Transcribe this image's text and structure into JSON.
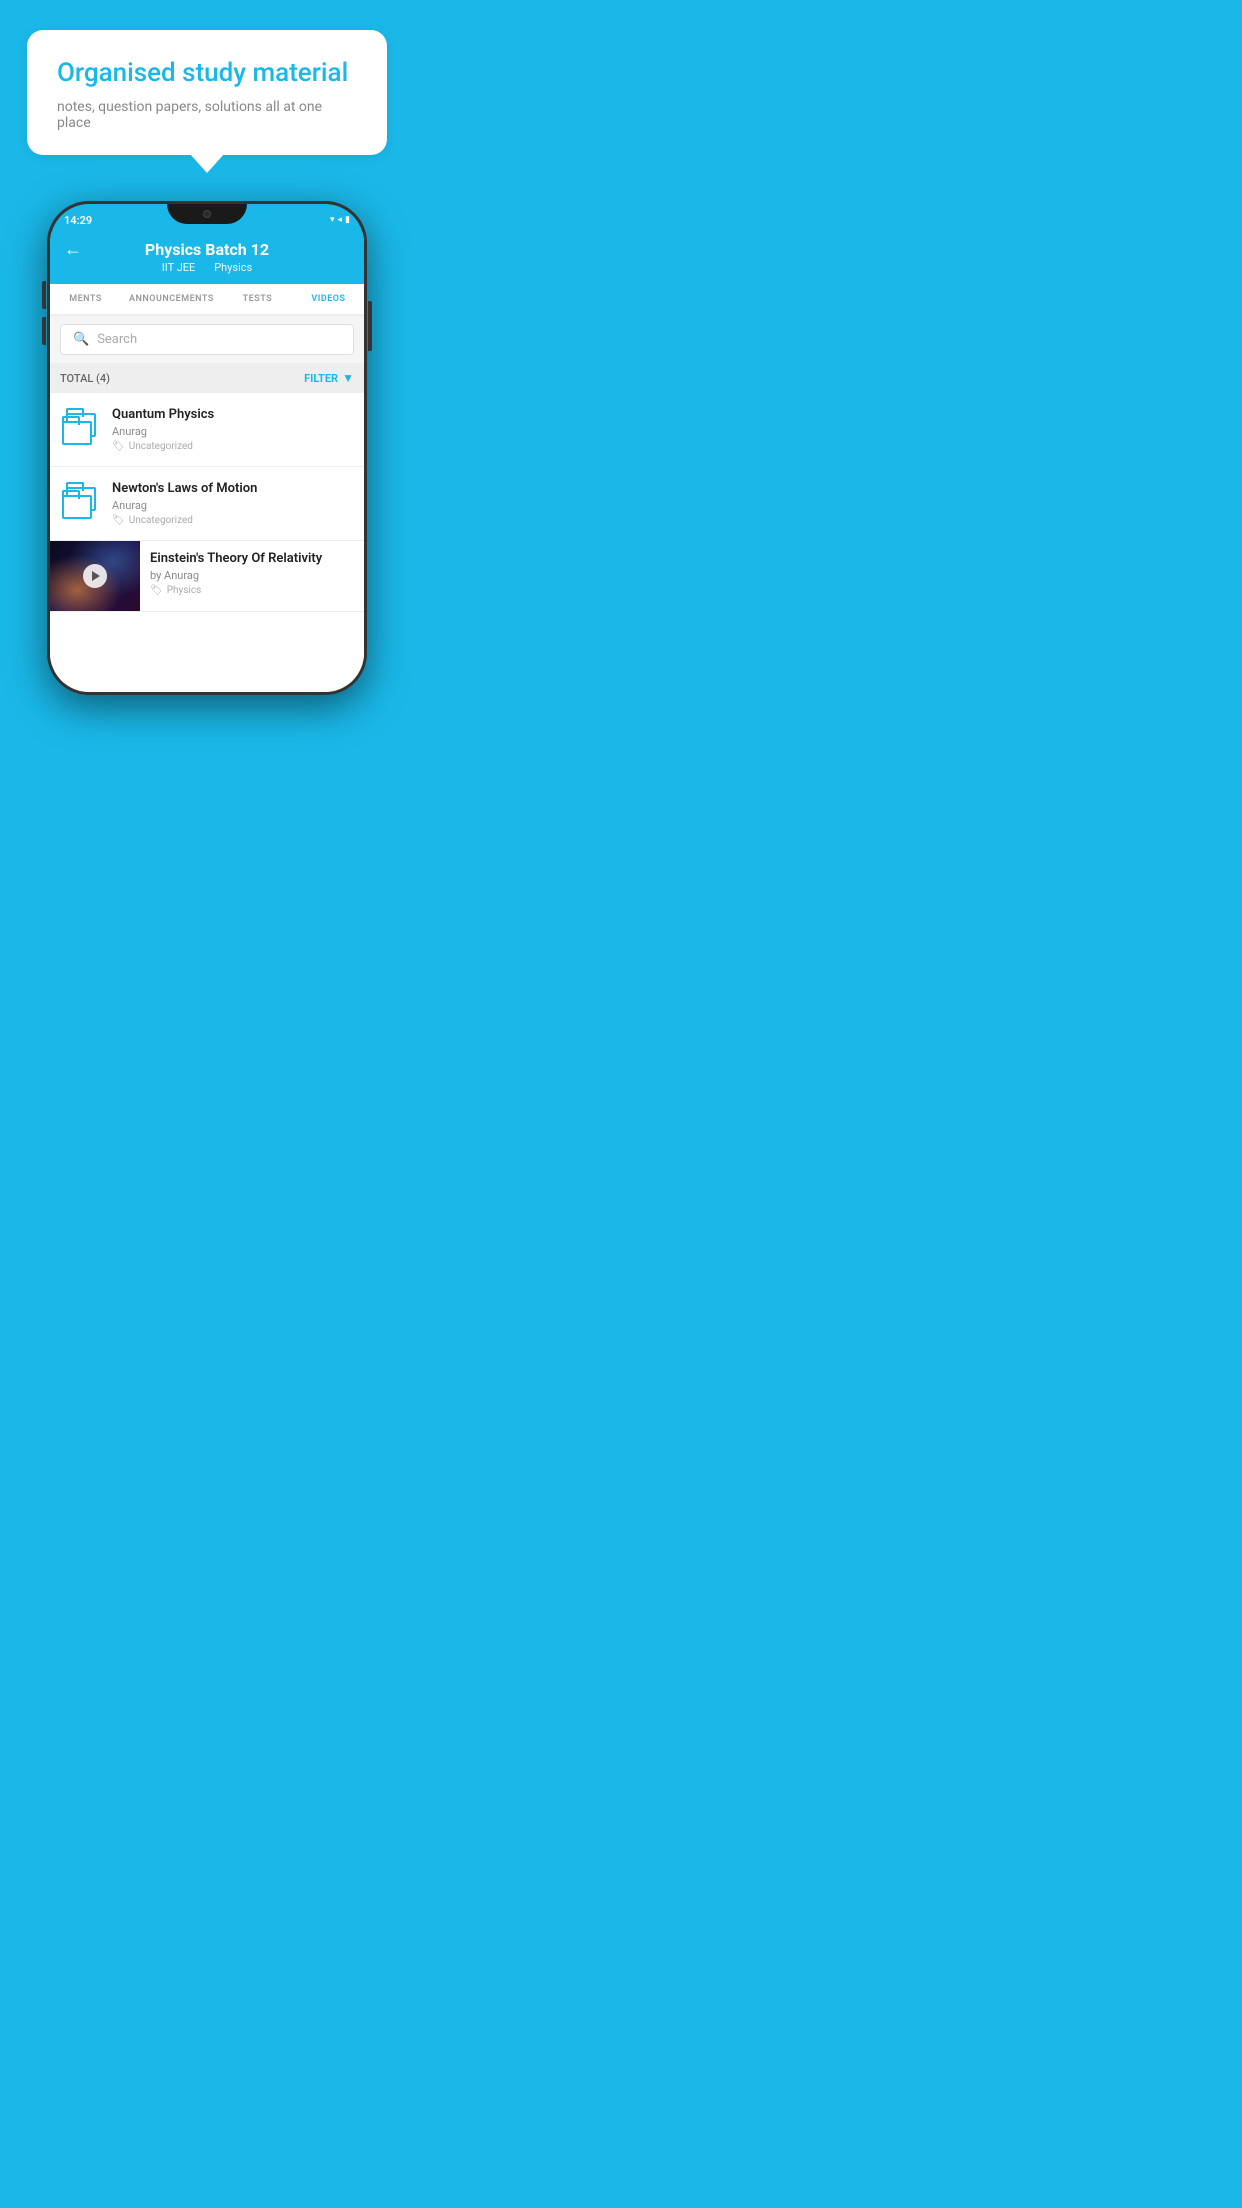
{
  "background_color": "#1ab8e8",
  "bubble": {
    "title": "Organised study material",
    "subtitle": "notes, question papers, solutions all at one place"
  },
  "phone": {
    "status_bar": {
      "time": "14:29",
      "icons": "▾◂▮"
    },
    "header": {
      "title": "Physics Batch 12",
      "subtitle_part1": "IIT JEE",
      "subtitle_part2": "Physics",
      "back_label": "←"
    },
    "tabs": [
      {
        "label": "MENTS",
        "active": false
      },
      {
        "label": "ANNOUNCEMENTS",
        "active": false
      },
      {
        "label": "TESTS",
        "active": false
      },
      {
        "label": "VIDEOS",
        "active": true
      }
    ],
    "search": {
      "placeholder": "Search"
    },
    "filter": {
      "total_label": "TOTAL (4)",
      "filter_label": "FILTER"
    },
    "videos": [
      {
        "id": 1,
        "title": "Quantum Physics",
        "author": "Anurag",
        "tag": "Uncategorized",
        "type": "folder"
      },
      {
        "id": 2,
        "title": "Newton's Laws of Motion",
        "author": "Anurag",
        "tag": "Uncategorized",
        "type": "folder"
      },
      {
        "id": 3,
        "title": "Einstein's Theory Of Relativity",
        "author": "by Anurag",
        "tag": "Physics",
        "type": "video"
      }
    ]
  }
}
